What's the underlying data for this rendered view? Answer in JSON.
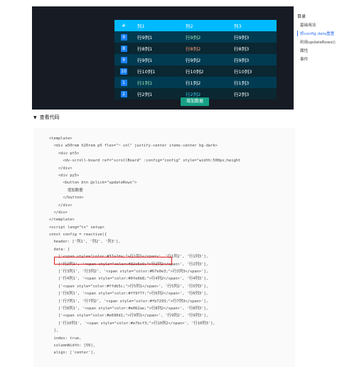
{
  "board": {
    "header": [
      "#",
      "列1",
      "列2",
      "列3"
    ],
    "rows": [
      {
        "index": "9",
        "c1": "行9列1",
        "c2": "行9列2",
        "c3": "行9列3",
        "c2_color": "#9fe6b8"
      },
      {
        "index": "8",
        "c1": "行8列1",
        "c2": "行8列2",
        "c3": "行8列3",
        "c2_color": "#ff9f7f"
      },
      {
        "index": "9",
        "c1": "行9列1",
        "c2": "行9列2",
        "c3": "行9列3",
        "c2_color": "#ffffff"
      },
      {
        "index": "10",
        "c1": "行10列1",
        "c2": "行10列2",
        "c3": "行10列3",
        "c2_color": "#ffffff"
      },
      {
        "index": "1",
        "c1": "行1列1",
        "c2": "行1列2",
        "c3": "行1列3",
        "c2_color": "#ffffff",
        "c1_color": "#9fe6b8"
      },
      {
        "index": "2",
        "c1": "行2列1",
        "c2": "行2列2",
        "c3": "行2列3",
        "c2_color": "#32c5e9"
      }
    ],
    "button_label": "增加数据"
  },
  "toc": {
    "title": "目录",
    "items": [
      {
        "label": "基础用法",
        "active": false
      },
      {
        "label": "修config.data重置",
        "active": true
      },
      {
        "label": "利用updateRows()",
        "active": false
      },
      {
        "label": "属性",
        "active": false
      },
      {
        "label": "事件",
        "active": false
      }
    ]
  },
  "toggle": {
    "label": "查看代码"
  },
  "code": {
    "lines": [
      "<template>",
      "  <div w50rem h20rem p5 flex=\"~ col\" justify-center items-center bg-dark>",
      "    <div pt5>",
      "      <dv-scroll-board ref=\"scrollBoard\" :config=\"config\" style=\"width:500px;height",
      "    </div>",
      "    <div py5>",
      "      <button btn @click=\"updateRows\">",
      "        增加数据",
      "      </button>",
      "    </div>",
      "  </div>",
      "</template>",
      "<script lang=\"ts\" setup>",
      "const config = reactive({",
      "  header: ['列1', '列2', '列3'],",
      "  data: [",
      "    ['<span style=\"color:#37a2da;\">行1列1</span>', '行1列2', '行1列3'],",
      "    ['行2列1', '<span style=\"color:#32c5e9;\">行2列2</span>', '行2列3'],",
      "    ['行3列1', '行3列2', '<span style=\"color:#67e0e3;\">行3列3</span>'],",
      "    ['行4列1', '<span style=\"color:#9fe6b8;\">行4列2</span>', '行4列3'],",
      "    ['<span style=\"color:#ffdb5c;\">行5列1</span>', '行5列2', '行5列3'],",
      "    ['行6列1', '<span style=\"color:#ff9f7f;\">行6列2</span>', '行6列3'],",
      "    ['行7列1', '行7列2', '<span style=\"color:#fb7293;\">行7列3</span>'],",
      "    ['行8列1', '<span style=\"color:#e062ae;\">行8列2</span>', '行8列3'],",
      "    ['<span style=\"color:#e690d1;\">行9列1</span>', '行9列2', '行9列3'],",
      "    ['行10列1', '<span style=\"color:#e7bcf3;\">行10列2</span>', '行10列3'],",
      "  ],",
      "  index: true,",
      "  columnWidth: [50],",
      "  align: ['center'],"
    ]
  }
}
